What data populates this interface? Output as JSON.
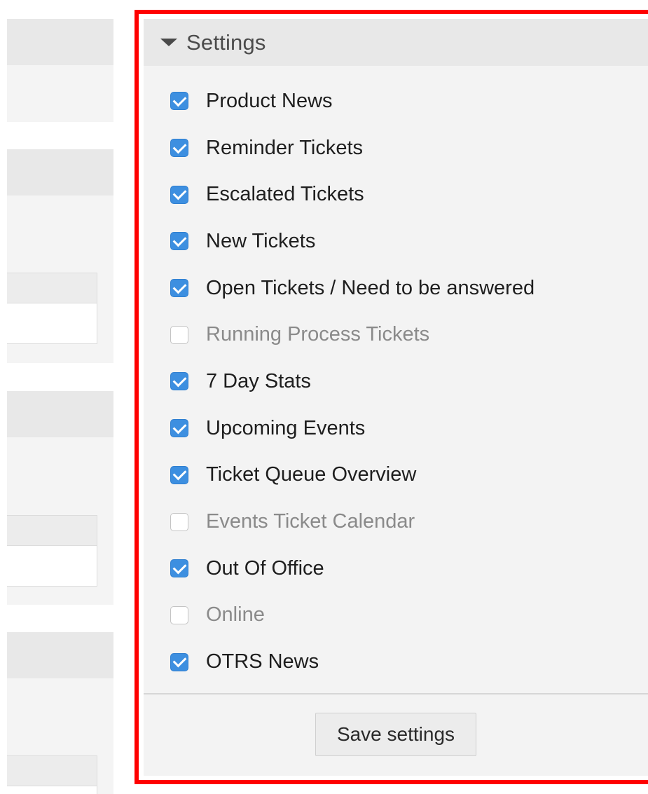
{
  "settings": {
    "title": "Settings",
    "options": [
      {
        "label": "Product News",
        "checked": true
      },
      {
        "label": "Reminder Tickets",
        "checked": true
      },
      {
        "label": "Escalated Tickets",
        "checked": true
      },
      {
        "label": "New Tickets",
        "checked": true
      },
      {
        "label": "Open Tickets / Need to be answered",
        "checked": true
      },
      {
        "label": "Running Process Tickets",
        "checked": false
      },
      {
        "label": "7 Day Stats",
        "checked": true
      },
      {
        "label": "Upcoming Events",
        "checked": true
      },
      {
        "label": "Ticket Queue Overview",
        "checked": true
      },
      {
        "label": "Events Ticket Calendar",
        "checked": false
      },
      {
        "label": "Out Of Office",
        "checked": true
      },
      {
        "label": "Online",
        "checked": false
      },
      {
        "label": "OTRS News",
        "checked": true
      }
    ],
    "save_label": "Save settings"
  },
  "colors": {
    "highlight": "#ff0000",
    "checkbox_checked": "#3d8fe0",
    "panel_background": "#f3f3f3",
    "header_background": "#e8e8e8"
  }
}
